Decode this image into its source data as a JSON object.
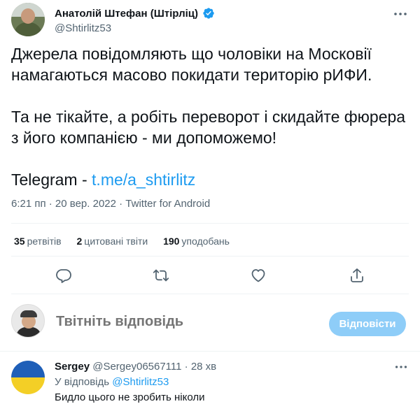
{
  "tweet": {
    "author_name": "Анатолій Штефан (Штірліц)",
    "author_handle": "@Shtirlitz53",
    "text_line1": "Джерела повідомляють що чоловіки на Московії",
    "text_line2": "намагаються масово покидати територію рИФИ.",
    "text_line3": "Та не тікайте, а робіть переворот і скидайте фюрера",
    "text_line4": "з його компанією - ми допоможемо!",
    "telegram_prefix": "Telegram - ",
    "telegram_link": "t.me/a_shtirlitz",
    "meta": "6:21 пп · 20 вер. 2022 · Twitter for Android"
  },
  "stats": {
    "retweets_count": "35",
    "retweets_label": "ретвітів",
    "quotes_count": "2",
    "quotes_label": "цитовані твіти",
    "likes_count": "190",
    "likes_label": "уподобань"
  },
  "actions": [
    "reply-icon",
    "retweet-icon",
    "like-icon",
    "share-icon"
  ],
  "reply_box": {
    "placeholder": "Твітніть відповідь",
    "button_label": "Відповісти"
  },
  "comment": {
    "name": "Sergey",
    "handle_time": "@Sergey06567111 · 28 хв",
    "reply_prefix": "У відповідь ",
    "reply_handle": "@Shtirlitz53",
    "text": "Бидло цього не зробить ніколи"
  },
  "colors": {
    "accent": "#1d9bf0",
    "muted": "#536471",
    "text": "#0f1419",
    "button_disabled": "#8ecdf8"
  }
}
